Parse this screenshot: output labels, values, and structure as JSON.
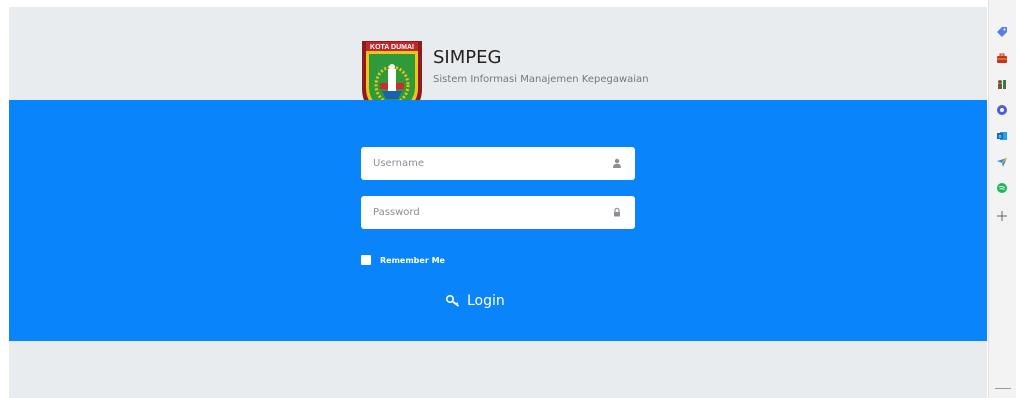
{
  "header": {
    "title": "SIMPEG",
    "subtitle": "Sistem Informasi Manajemen Kepegawaian",
    "logo_text": "KOTA DUMAI"
  },
  "form": {
    "username": {
      "placeholder": "Username",
      "value": "",
      "icon": "user-icon"
    },
    "password": {
      "placeholder": "Password",
      "value": "",
      "icon": "lock-icon"
    },
    "remember_label": "Remember Me",
    "remember_checked": false,
    "login_label": "Login",
    "login_icon": "key-icon"
  },
  "sidebar": {
    "icons": [
      "tag-icon",
      "briefcase-icon",
      "chess-icon",
      "office-icon",
      "outlook-icon",
      "send-icon",
      "spotify-icon",
      "add-icon"
    ]
  },
  "colors": {
    "band": "#0a84fa",
    "background": "#e9ecef",
    "field_background": "#ffffff"
  }
}
